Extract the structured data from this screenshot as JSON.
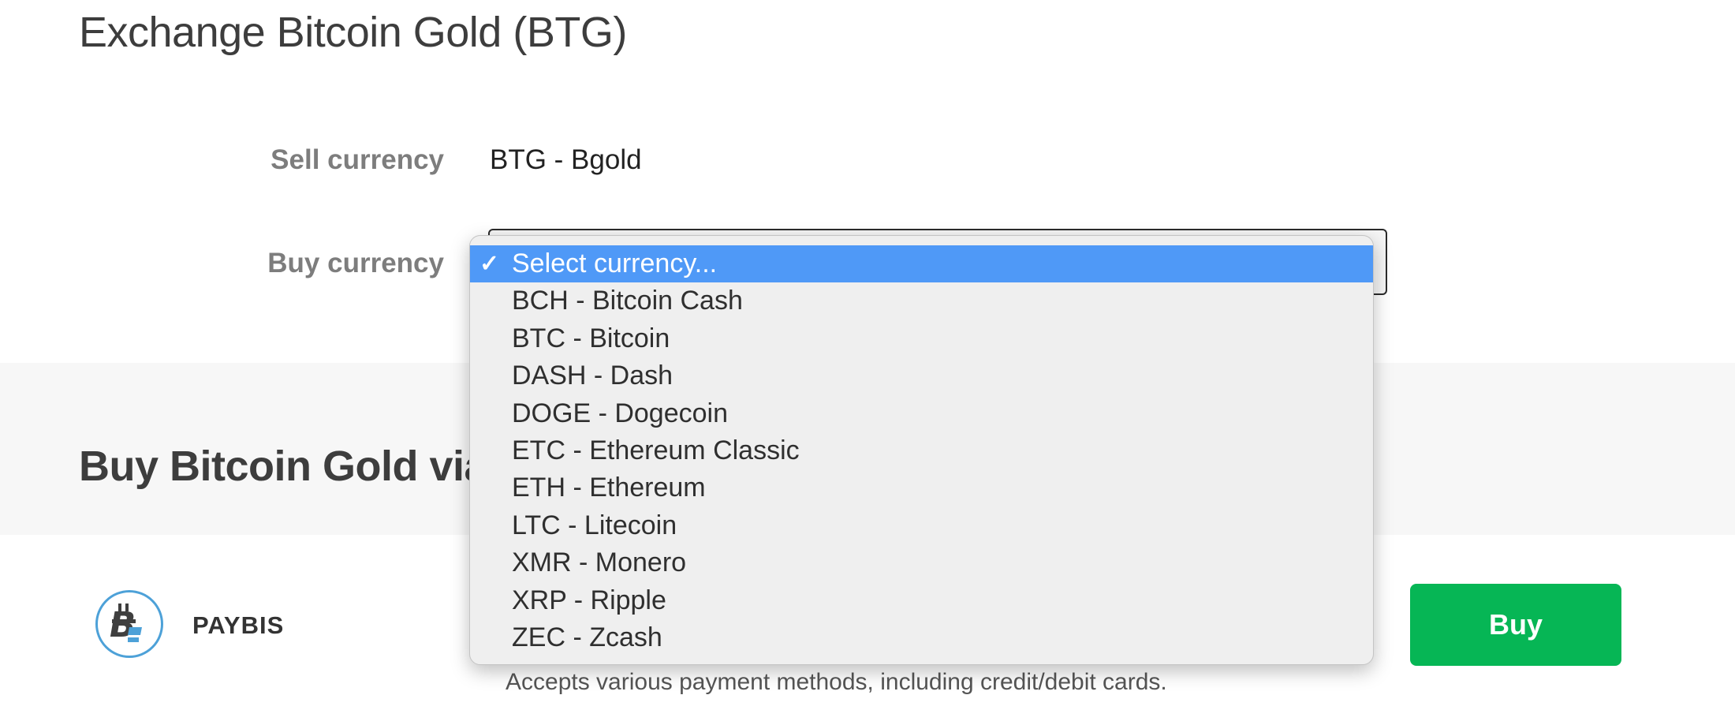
{
  "page": {
    "title": "Exchange Bitcoin Gold (BTG)"
  },
  "form": {
    "sell_label": "Sell currency",
    "sell_value": "BTG - Bgold",
    "buy_label": "Buy currency"
  },
  "dropdown": {
    "check": "✓",
    "selected_index": 0,
    "options": [
      "Select currency...",
      "BCH - Bitcoin Cash",
      "BTC - Bitcoin",
      "DASH - Dash",
      "DOGE - Dogecoin",
      "ETC - Ethereum Classic",
      "ETH - Ethereum",
      "LTC - Litecoin",
      "XMR - Monero",
      "XRP - Ripple",
      "ZEC - Zcash"
    ]
  },
  "section": {
    "title_visible": "Buy Bitcoin Gold via c"
  },
  "provider": {
    "logo_icon": "bitcoin-gold-icon",
    "name": "PAYBIS",
    "description": "Accepts various payment methods, including credit/debit cards.",
    "buy_label": "Buy"
  },
  "colors": {
    "selected_option": "#4f99f7",
    "buy_button": "#06b655",
    "logo_ring": "#4da1d8"
  }
}
